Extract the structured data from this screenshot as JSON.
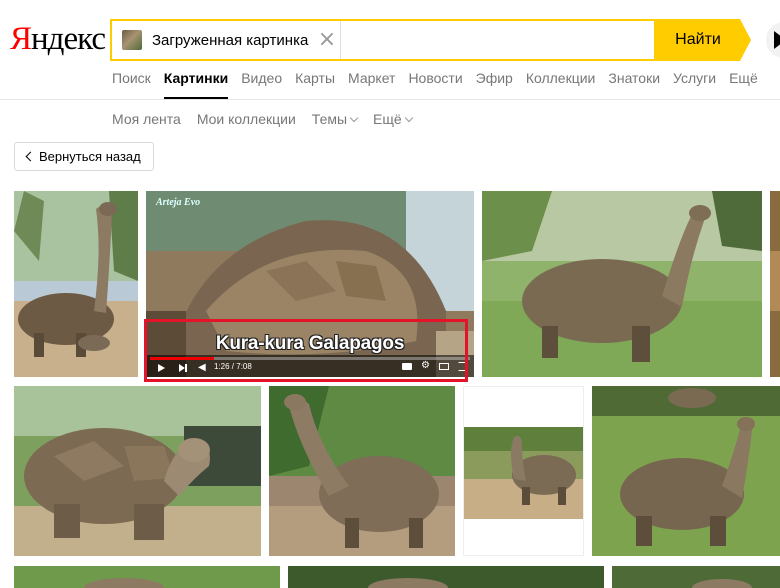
{
  "logo": {
    "first_letter": "Я",
    "rest": "ндекс"
  },
  "search": {
    "chip_label": "Загруженная картинка",
    "chip_close": "×",
    "query_value": "",
    "query_placeholder": "",
    "find_button": "Найти"
  },
  "nav": {
    "items": [
      "Поиск",
      "Картинки",
      "Видео",
      "Карты",
      "Маркет",
      "Новости",
      "Эфир",
      "Коллекции",
      "Знатоки",
      "Услуги",
      "Ещё"
    ],
    "active_index": 1
  },
  "subnav": {
    "items": [
      "Моя лента",
      "Мои коллекции",
      "Темы",
      "Ещё"
    ]
  },
  "back_button": "Вернуться назад",
  "video": {
    "caption": "Kura-kura Galapagos",
    "watermark": "Arteja Evo",
    "time": "1:26 / 7:08",
    "progress": 0.2
  },
  "colors": {
    "accent": "#ffcc00",
    "logo_red": "#ff0000",
    "highlight": "#e3142a"
  }
}
